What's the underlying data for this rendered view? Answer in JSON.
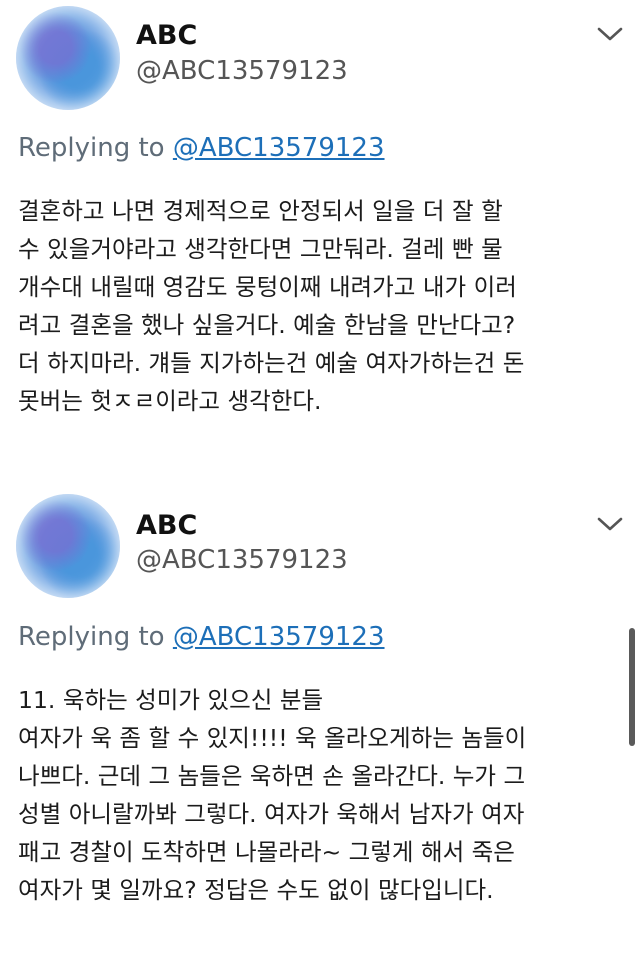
{
  "tweets": [
    {
      "name": "ABC",
      "handle": "@ABC13579123",
      "reply_prefix": "Replying to ",
      "reply_handle": "@ABC13579123",
      "text": "결혼하고 나면 경제적으로 안정되서 일을 더 잘 할\n수 있을거야라고 생각한다면 그만둬라. 걸레 빤 물\n개수대 내릴때 영감도 뭉텅이째 내려가고 내가 이러\n려고 결혼을 했나 싶을거다. 예술 한남을 만난다고?\n더 하지마라. 걔들 지가하는건 예술 여자가하는건 돈\n못버는 헛ㅈㄹ이라고 생각한다."
    },
    {
      "name": "ABC",
      "handle": "@ABC13579123",
      "reply_prefix": "Replying to ",
      "reply_handle": "@ABC13579123",
      "text": "11. 욱하는 성미가 있으신 분들\n 여자가 욱 좀 할 수 있지!!!! 욱 올라오게하는 놈들이\n나쁘다. 근데 그 놈들은 욱하면 손 올라간다. 누가 그\n성별 아니랄까봐 그렇다. 여자가 욱해서 남자가 여자\n패고 경찰이 도착하면 나몰라라~ 그렇게 해서 죽은\n여자가 몇 일까요? 정답은 수도 없이 많다입니다."
    }
  ],
  "icons": {
    "avatar": "avatar-image",
    "menu": "chevron-down-icon"
  }
}
